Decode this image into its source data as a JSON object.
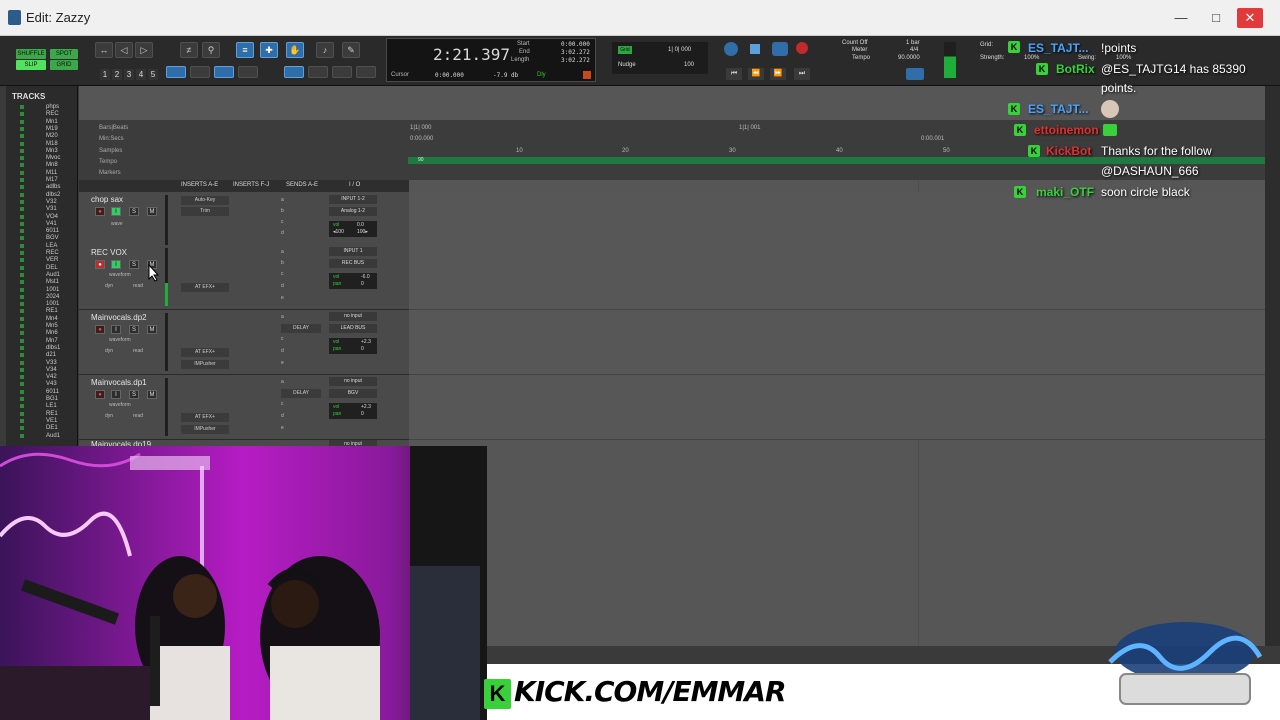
{
  "window": {
    "title": "Edit: Zazzy"
  },
  "toolbar": {
    "modes": {
      "shuffle": "SHUFFLE",
      "spot": "SPOT",
      "slip": "SLIP",
      "grid": "GRID"
    },
    "zoom_presets": [
      "1",
      "2",
      "3",
      "4",
      "5"
    ],
    "counter": {
      "main": "2:21.397",
      "start_label": "Start",
      "start": "0:00.000",
      "end_label": "End",
      "end": "3:02.272",
      "length_label": "Length",
      "length": "3:02.272",
      "cursor_label": "Cursor",
      "cursor": "0:00.000",
      "db": "-7.9 db",
      "dly": "Dly"
    },
    "grid": {
      "label": "Grid",
      "value": "1| 0| 000"
    },
    "nudge": {
      "label": "Nudge",
      "value": "100"
    },
    "count_off": "Count Off",
    "meter_label": "Meter",
    "tempo_label": "Tempo",
    "meter_value": "1 bar",
    "meter_sig": "4/4",
    "tempo_value": "90.0000",
    "grid_right_label": "Grid:",
    "strength_label": "Strength:",
    "swing_label": "Swing:",
    "pct_a": "100%",
    "pct_b": "100%"
  },
  "tracklist": {
    "header": "TRACKS",
    "items": [
      "phps",
      "REC",
      "Mn1",
      "M19",
      "M20",
      "M18",
      "Mn3",
      "Mvoc",
      "Mn8",
      "M11",
      "M17",
      "adlbs",
      "dlbs2",
      "V32",
      "V31",
      "VO4",
      "V41",
      "6011",
      "BGV",
      "LEA",
      "REC",
      "VER",
      "DEL",
      "Aud1",
      "Mst1",
      "1001",
      "2024",
      "1001",
      "RE1",
      "Mn4",
      "Mn5",
      "Mn6",
      "Mn7",
      "dlbs1",
      "d21",
      "V33",
      "V34",
      "V42",
      "V43",
      "6011",
      "BG1",
      "LE1",
      "RE1",
      "VE1",
      "DE1",
      "Aud1"
    ]
  },
  "rulers": {
    "labels": [
      "Bars|Beats",
      "Min:Secs",
      "Samples",
      "Tempo",
      "Markers"
    ],
    "bars": [
      "1|1| 000",
      "1|1| 001"
    ],
    "minsecs": [
      "0:00.000",
      "0:00.001"
    ],
    "samples": [
      "10",
      "20",
      "30",
      "40",
      "50"
    ],
    "tempo_value": "90"
  },
  "columns": {
    "inserts_ae": "INSERTS A-E",
    "inserts_fj": "INSERTS F-J",
    "sends_ae": "SENDS A-E",
    "io": "I / O"
  },
  "tracks": [
    {
      "name": "chop sax",
      "view": "wave",
      "inserts": [
        "Auto-Key",
        "Trim"
      ],
      "sends": [
        "a",
        "b",
        "c",
        "d"
      ],
      "input": "INPUT 1-2",
      "output": "Analog 1-2",
      "vol_label": "vol",
      "vol": "0.0",
      "pan_left": "◂100",
      "pan_right": "100▸"
    },
    {
      "name": "REC VOX",
      "view": "waveform",
      "auto": "dyn",
      "mode": "read",
      "inserts": [
        "AT EFX+"
      ],
      "sends": [
        "a",
        "b",
        "c",
        "d",
        "e"
      ],
      "input": "INPUT 1",
      "output": "REC BUS",
      "vol_label": "vol",
      "vol": "-6.0",
      "pan_label": "pan",
      "pan": "0"
    },
    {
      "name": "Mainvocals.dp2",
      "view": "waveform",
      "auto": "dyn",
      "mode": "read",
      "inserts": [
        "AT EFX+",
        "IMPusher"
      ],
      "send_b": "DELAY",
      "sends": [
        "a",
        "b",
        "c",
        "d",
        "e"
      ],
      "input": "no input",
      "output": "LEAD BUS",
      "vol_label": "vol",
      "vol": "+2.3",
      "pan_label": "pan",
      "pan": "0"
    },
    {
      "name": "Mainvocals.dp1",
      "view": "waveform",
      "auto": "dyn",
      "mode": "read",
      "inserts": [
        "AT EFX+",
        "IMPusher"
      ],
      "send_b": "DELAY",
      "sends": [
        "a",
        "b",
        "c",
        "d",
        "e"
      ],
      "input": "no input",
      "output": "BGV",
      "vol_label": "vol",
      "vol": "+2.3",
      "pan_label": "pan",
      "pan": "0"
    },
    {
      "name": "Mainvocals.dp19",
      "input": "no input"
    }
  ],
  "track_buttons": {
    "solo": "S",
    "mute": "M",
    "input": "I"
  },
  "chat": {
    "messages": [
      {
        "user": "ES_TAJT...",
        "user_color": "#4aa3ff",
        "text": "!points"
      },
      {
        "user": "BotRix",
        "user_color": "#38d13a",
        "text": "@ES_TAJTG14 has 85390"
      },
      {
        "user": "",
        "user_color": "#ffffff",
        "text": "points."
      },
      {
        "user": "ES_TAJT...",
        "user_color": "#4aa3ff",
        "text": ""
      },
      {
        "user": "ettoinemon",
        "user_color": "#e03030",
        "text": ""
      },
      {
        "user": "KickBot",
        "user_color": "#e03030",
        "text": "Thanks for the follow"
      },
      {
        "user": "",
        "user_color": "#ffffff",
        "text": "@DASHAUN_666"
      },
      {
        "user": "maki_OTF",
        "user_color": "#38d13a",
        "text": "soon circle black"
      }
    ],
    "badge": "K"
  },
  "footer": {
    "kick_logo": "K",
    "url": "KICK.COM/EMMAR"
  },
  "colors": {
    "accent_green": "#38d13a",
    "tempo_green": "#1f7a3f",
    "record_red": "#c02a2a"
  }
}
